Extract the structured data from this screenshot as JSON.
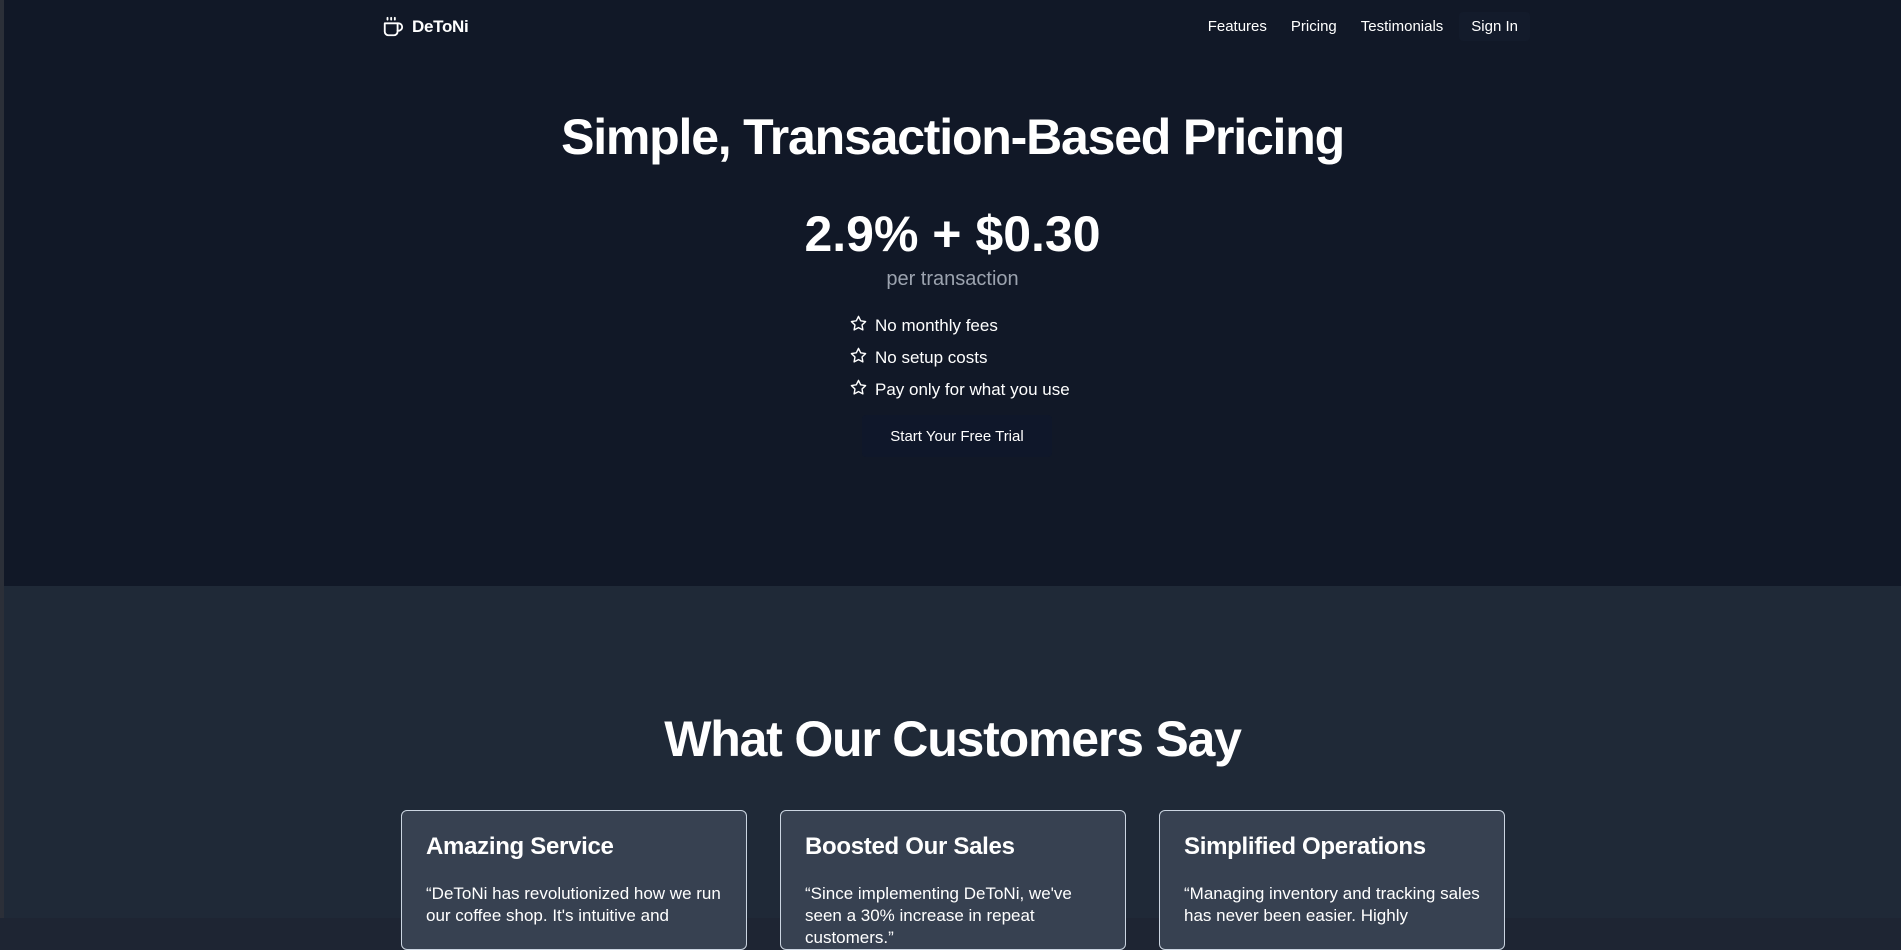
{
  "brand": {
    "name": "DeToNi",
    "icon": "coffee-cup-icon"
  },
  "nav": {
    "links": [
      "Features",
      "Pricing",
      "Testimonials"
    ],
    "signin_label": "Sign In"
  },
  "hero": {
    "title": "Simple, Transaction-Based Pricing",
    "price": "2.9% + $0.30",
    "price_sub": "per transaction",
    "features": [
      "No monthly fees",
      "No setup costs",
      "Pay only for what you use"
    ],
    "feature_icon": "star-outline-icon",
    "cta_label": "Start Your Free Trial"
  },
  "testimonials": {
    "title": "What Our Customers Say",
    "cards": [
      {
        "title": "Amazing Service",
        "quote": "“DeToNi has revolutionized how we run our coffee shop. It's intuitive and"
      },
      {
        "title": "Boosted Our Sales",
        "quote": "“Since implementing DeToNi, we've seen a 30% increase in repeat customers.”"
      },
      {
        "title": "Simplified Operations",
        "quote": "“Managing inventory and tracking sales has never been easier. Highly"
      }
    ]
  },
  "colors": {
    "hero_bg": "#111827",
    "section_bg": "#1f2937",
    "card_bg": "#374151",
    "muted_text": "#9ca3af"
  }
}
